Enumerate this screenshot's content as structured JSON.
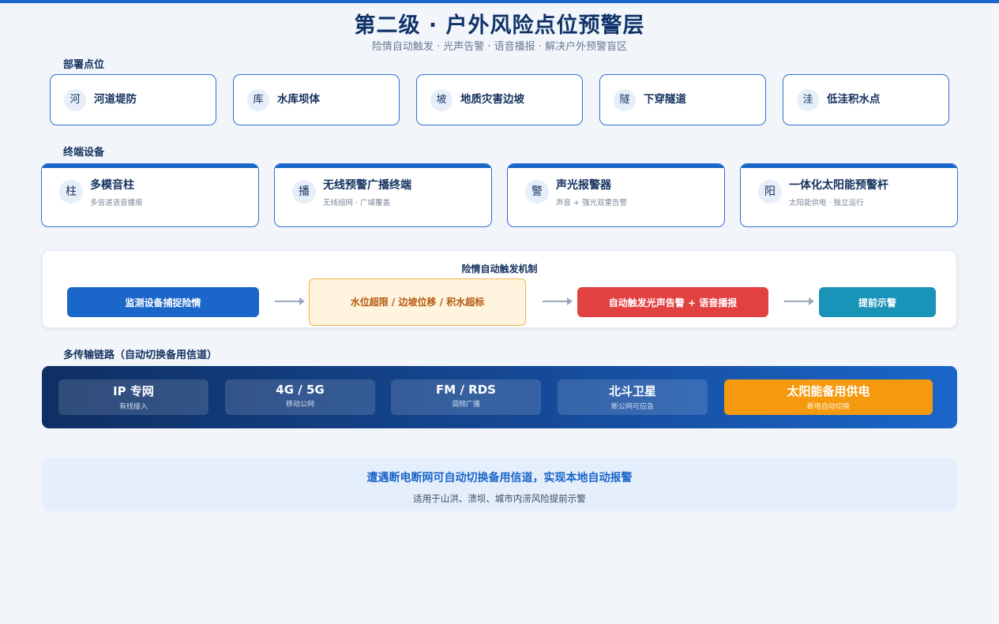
{
  "header": {
    "title": "第二级 · 户外风险点位预警层",
    "subtitle": "险情自动触发 · 光声告警 · 语音播报 · 解决户外预警盲区"
  },
  "deploy": {
    "label": "部署点位",
    "points": [
      {
        "badge": "河",
        "label": "河道堤防"
      },
      {
        "badge": "库",
        "label": "水库坝体"
      },
      {
        "badge": "坡",
        "label": "地质灾害边坡"
      },
      {
        "badge": "隧",
        "label": "下穿隧道"
      },
      {
        "badge": "洼",
        "label": "低洼积水点"
      }
    ]
  },
  "devices": {
    "label": "终端设备",
    "items": [
      {
        "badge": "柱",
        "title": "多模音柱",
        "sub": "多信道语音播报"
      },
      {
        "badge": "播",
        "title": "无线预警广播终端",
        "sub": "无线组网 · 广域覆盖"
      },
      {
        "badge": "警",
        "title": "声光报警器",
        "sub": "声音 + 强光双重告警"
      },
      {
        "badge": "阳",
        "title": "一体化太阳能预警杆",
        "sub": "太阳能供电 · 独立运行"
      }
    ]
  },
  "trigger": {
    "title": "险情自动触发机制",
    "steps": [
      "监测设备捕捉险情",
      "水位超限 / 边坡位移 / 积水超标",
      "自动触发光声告警 + 语音播报",
      "提前示警"
    ]
  },
  "transport": {
    "label": "多传输链路（自动切换备用信道）",
    "links": [
      {
        "name": "IP 专网",
        "sub": "有线接入"
      },
      {
        "name": "4G / 5G",
        "sub": "移动公网"
      },
      {
        "name": "FM / RDS",
        "sub": "调频广播"
      },
      {
        "name": "北斗卫星",
        "sub": "断公网可应急"
      },
      {
        "name": "太阳能备用供电",
        "sub": "断电自动切换"
      }
    ]
  },
  "note": {
    "main": "遭遇断电断网可自动切换备用信道，实现本地自动报警",
    "sub": "适用于山洪、溃坝、城市内涝风险提前示警"
  },
  "colors": {
    "primary": "#1a66c9",
    "navy": "#0f3369",
    "alert_red": "#e24142",
    "warn_orange": "#f59a0e",
    "teal": "#1a93b8",
    "page_bg": "#f2f6fb"
  }
}
